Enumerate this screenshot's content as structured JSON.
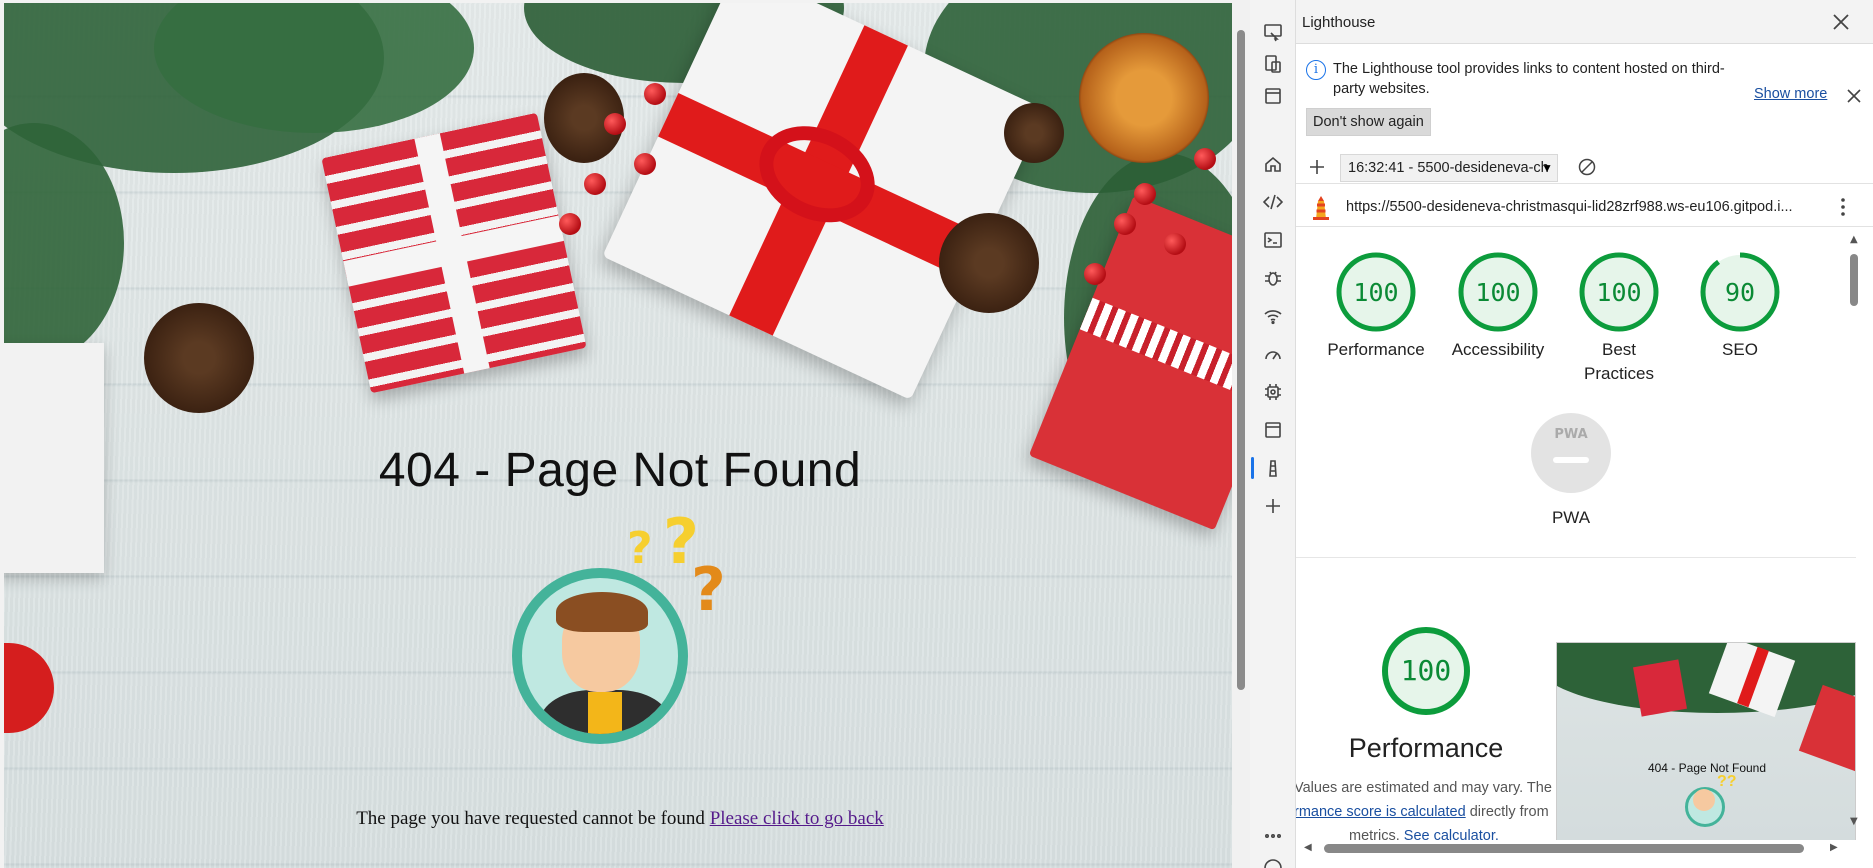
{
  "page": {
    "heading": "404 - Page Not Found",
    "message": "The page you have requested cannot be found",
    "back_link": "Please click to go back"
  },
  "devtools": {
    "activity_bar": [
      "screencast-icon",
      "device-toolbar-icon",
      "dock-icon",
      "welcome-home-icon",
      "elements-code-icon",
      "console-icon",
      "sources-bug-icon",
      "network-wifi-icon",
      "performance-gauge-icon",
      "memory-chip-icon",
      "application-window-icon",
      "lighthouse-icon",
      "more-tools-plus-icon"
    ],
    "active_tool": "lighthouse-icon"
  },
  "lighthouse": {
    "title": "Lighthouse",
    "info": {
      "text": "The Lighthouse tool provides links to content hosted on third-party websites.",
      "show_more": "Show more",
      "dont_show": "Don't show again"
    },
    "report_select": "16:32:41 - 5500-desideneva-ch",
    "report_url": "https://5500-desideneva-christmasqui-lid28zrf988.ws-eu106.gitpod.i...",
    "scores": [
      {
        "label": "Performance",
        "value": "100",
        "score": 100,
        "color": "#0c9c3c",
        "fill": "#e6f5ea"
      },
      {
        "label": "Accessibility",
        "value": "100",
        "score": 100,
        "color": "#0c9c3c",
        "fill": "#e6f5ea"
      },
      {
        "label": "Best Practices",
        "value": "100",
        "score": 100,
        "color": "#0c9c3c",
        "fill": "#e6f5ea"
      },
      {
        "label": "SEO",
        "value": "90",
        "score": 90,
        "color": "#0c9c3c",
        "fill": "#e6f5ea"
      }
    ],
    "pwa": {
      "badge": "PWA",
      "label": "PWA"
    },
    "performance_detail": {
      "score": "100",
      "title": "Performance",
      "desc_1": "Values are estimated and may vary. The",
      "desc_link": "rmance score is calculated",
      "desc_2": " directly from",
      "desc_3": "metrics.",
      "calc_link": "See calculator."
    },
    "screenshot_heading": "404 - Page Not Found"
  }
}
